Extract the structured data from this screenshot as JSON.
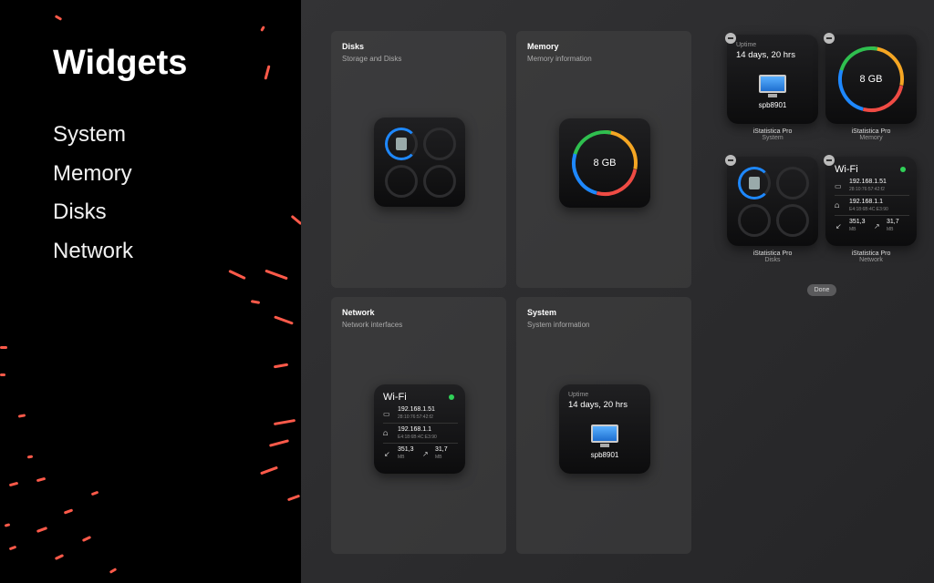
{
  "sidebar": {
    "title": "Widgets",
    "items": [
      {
        "label": "System"
      },
      {
        "label": "Memory"
      },
      {
        "label": "Disks"
      },
      {
        "label": "Network"
      }
    ]
  },
  "cards": {
    "disks": {
      "title": "Disks",
      "subtitle": "Storage and Disks"
    },
    "memory": {
      "title": "Memory",
      "subtitle": "Memory information",
      "value": "8 GB"
    },
    "network": {
      "title": "Network",
      "subtitle": "Network interfaces"
    },
    "system": {
      "title": "System",
      "subtitle": "System information"
    }
  },
  "widgets": {
    "uptime_label": "Uptime",
    "uptime": "14 days, 20 hrs",
    "host": "spb8901",
    "memory": "8 GB",
    "wifi": {
      "name": "Wi-Fi",
      "status_color": "#30d158",
      "ip1": "192.168.1.51",
      "mac1": "28:10:76:57:42:f2",
      "ip2": "192.168.1.1",
      "mac2": "E4:18:6B:4C:E3:90",
      "down": "351,3",
      "down_unit": "MB",
      "up": "31,7",
      "up_unit": "MB"
    }
  },
  "placed": [
    {
      "app": "iStatistica Pro",
      "kind": "System"
    },
    {
      "app": "iStatistica Pro",
      "kind": "Memory"
    },
    {
      "app": "iStatistica Pro",
      "kind": "Disks"
    },
    {
      "app": "iStatistica Pro",
      "kind": "Network"
    }
  ],
  "done_label": "Done",
  "colors": {
    "blue": "#1e88ff",
    "orange": "#f5a623",
    "red": "#ef4b44",
    "green": "#2fbf4f"
  }
}
